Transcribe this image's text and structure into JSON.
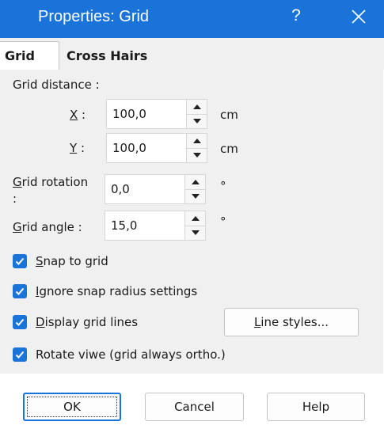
{
  "window": {
    "title": "Properties: Grid",
    "help": "?"
  },
  "tabs": [
    {
      "label": "Grid",
      "active": true
    },
    {
      "label": "Cross Hairs",
      "active": false
    }
  ],
  "grid_distance": {
    "heading": "Grid distance :",
    "x": {
      "key": "X",
      "sep": " :",
      "value": "100,0",
      "unit": "cm"
    },
    "y": {
      "key": "Y",
      "sep": " :",
      "value": "100,0",
      "unit": "cm"
    }
  },
  "grid_rotation": {
    "key": "G",
    "rest": "rid rotation",
    "colon": ":",
    "value": "0,0",
    "unit": "°"
  },
  "grid_angle": {
    "key": "G",
    "rest": "rid angle :",
    "value": "15,0",
    "unit": "°"
  },
  "options": [
    {
      "key": "S",
      "rest": "nap to grid",
      "checked": true
    },
    {
      "key": "I",
      "rest": "gnore snap radius settings",
      "checked": true
    },
    {
      "key": "D",
      "rest": "isplay grid lines",
      "checked": true
    },
    {
      "key": "",
      "rest": "Rotate viwe (grid always ortho.)",
      "checked": true
    }
  ],
  "line_styles_button": {
    "key": "L",
    "rest": "ine styles..."
  },
  "footer": {
    "ok": "OK",
    "cancel": "Cancel",
    "help": "Help"
  },
  "colors": {
    "accent": "#1a73d8",
    "panel": "#f0f0f0"
  }
}
